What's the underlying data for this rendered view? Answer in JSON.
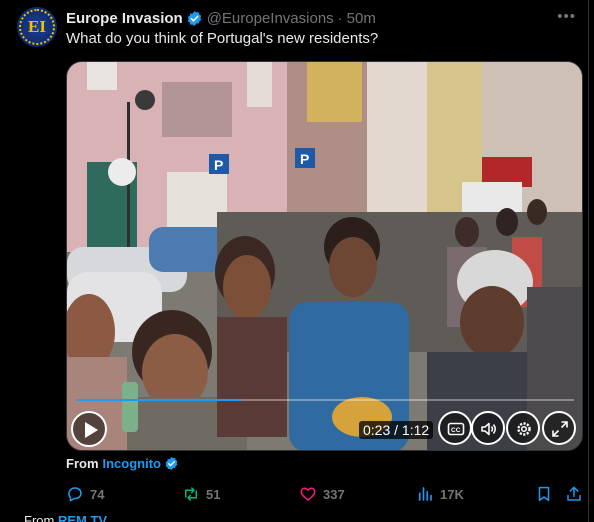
{
  "tweet": {
    "author": {
      "display_name": "Europe Invasion",
      "handle": "@EuropeInvasions",
      "separator": "·",
      "time": "50m",
      "avatar_monogram": "EI",
      "verified_color": "#1d9bf0"
    },
    "more_label": "•••",
    "text": "What do you think of Portugal's new residents?",
    "video": {
      "progress_fraction": 0.33,
      "timecode": "0:23 / 1:12",
      "controls": [
        "play-icon",
        "captions-icon",
        "volume-icon",
        "settings-icon",
        "fullscreen-icon"
      ]
    },
    "from_label": "From",
    "from_account": "Incognito",
    "actions": {
      "replies": "74",
      "reposts": "51",
      "likes": "337",
      "views": "17K"
    }
  },
  "next_item": {
    "from_label": "From",
    "from_account": "REM TV"
  }
}
